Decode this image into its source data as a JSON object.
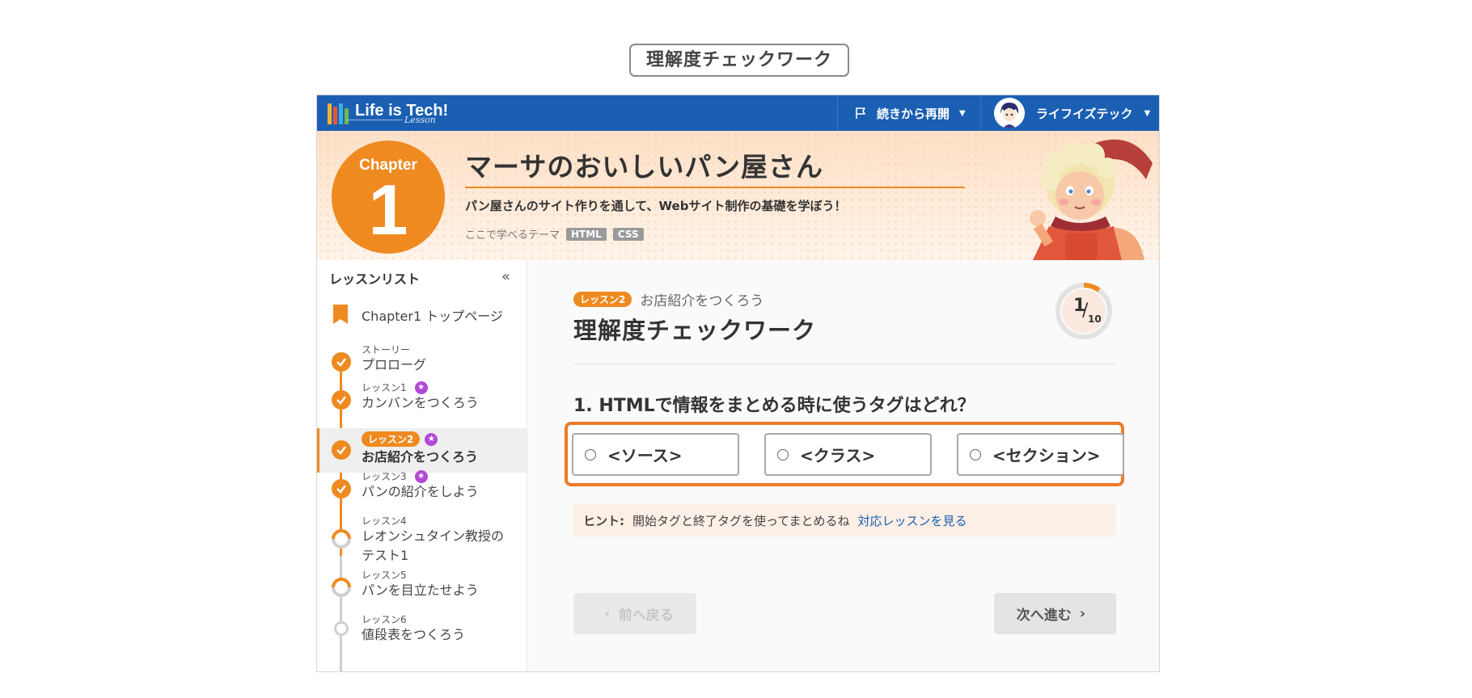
{
  "page_label": "理解度チェックワーク",
  "header": {
    "logo_text": "Life is Tech!",
    "logo_sub": "Lesson",
    "resume_label": "続きから再開",
    "user_name": "ライフイズテック"
  },
  "hero": {
    "chapter_word": "Chapter",
    "chapter_number": "1",
    "title": "マーサのおいしいパン屋さん",
    "description": "パン屋さんのサイト作りを通して、Webサイト制作の基礎を学ぼう！",
    "theme_label": "ここで学べるテーマ",
    "tags": [
      "HTML",
      "CSS"
    ]
  },
  "sidebar": {
    "heading": "レッスンリスト",
    "collapse_icon": "double-chevron-left-icon",
    "top_page_label": "Chapter1 トップページ",
    "lessons": [
      {
        "small": "ストーリー",
        "title": "プロローグ",
        "status": "done",
        "star": false
      },
      {
        "small": "レッスン1",
        "title": "カンバンをつくろう",
        "status": "done",
        "star": true
      },
      {
        "small": "レッスン2",
        "title": "お店紹介をつくろう",
        "status": "done",
        "star": true,
        "active": true
      },
      {
        "small": "レッスン3",
        "title": "パンの紹介をしよう",
        "status": "done",
        "star": true
      },
      {
        "small": "レッスン4",
        "title": "レオンシュタイン教授の",
        "title2": "テスト1",
        "status": "half",
        "star": false
      },
      {
        "small": "レッスン5",
        "title": "パンを目立たせよう",
        "status": "half",
        "star": false
      },
      {
        "small": "レッスン6",
        "title": "値段表をつくろう",
        "status": "empty",
        "star": false
      }
    ]
  },
  "main": {
    "lesson_pill": "レッスン2",
    "lesson_name": "お店紹介をつくろう",
    "title": "理解度チェックワーク",
    "progress": {
      "current": "1",
      "total": "10",
      "fraction": 0.1
    },
    "question": "1. HTMLで情報をまとめる時に使うタグはどれ？",
    "choices": [
      "<ソース>",
      "<クラス>",
      "<セクション>"
    ],
    "hint_label": "ヒント:",
    "hint_text": "開始タグと終了タグを使ってまとめるね",
    "hint_link": "対応レッスンを見る",
    "prev_label": "前へ戻る",
    "next_label": "次へ進む"
  },
  "colors": {
    "brand_blue": "#1b5fb3",
    "accent_orange": "#ef8a21",
    "highlight_border": "#ee7a2a",
    "star_purple": "#b04ad8"
  }
}
